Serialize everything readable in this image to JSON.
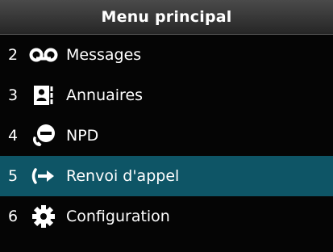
{
  "header": {
    "title": "Menu principal"
  },
  "menu": {
    "items": [
      {
        "number": "2",
        "label": "Messages",
        "icon": "voicemail-icon"
      },
      {
        "number": "3",
        "label": "Annuaires",
        "icon": "address-book-icon"
      },
      {
        "number": "4",
        "label": "NPD",
        "icon": "do-not-disturb-icon"
      },
      {
        "number": "5",
        "label": "Renvoi d'appel",
        "icon": "call-forward-icon",
        "selected": true
      },
      {
        "number": "6",
        "label": "Configuration",
        "icon": "gear-icon"
      }
    ]
  },
  "colors": {
    "background": "#050505",
    "selected_row": "#0e5566",
    "text": "#ffffff"
  }
}
